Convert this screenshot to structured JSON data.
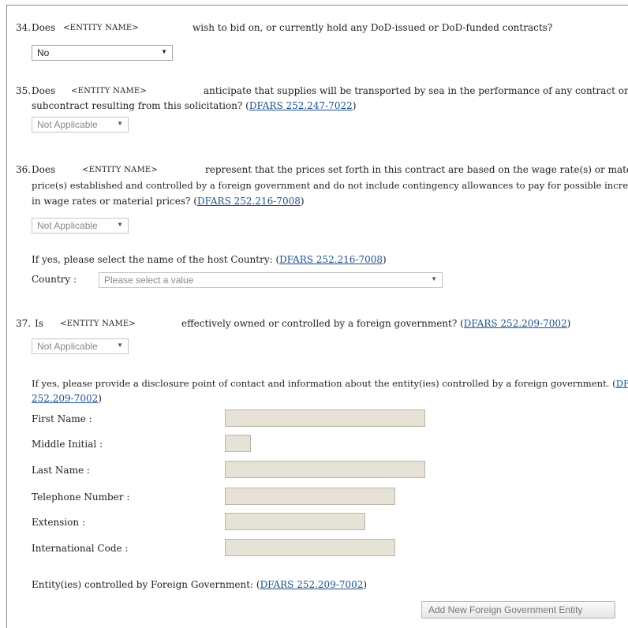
{
  "q34": {
    "number": "34.",
    "prefix": "Does",
    "entity": "<ENTITY NAME>",
    "text": "wish to bid on, or currently hold any DoD-issued or DoD-funded contracts?",
    "select_value": "No"
  },
  "q35": {
    "number": "35.",
    "prefix": "Does",
    "entity": "<ENTITY NAME>",
    "text_line1": "anticipate that supplies will be transported by sea in the performance of any contract or",
    "text_line2": "subcontract resulting from this solicitation? (",
    "ref": "DFARS 252.247-7022",
    "close": ")",
    "select_value": "Not Applicable"
  },
  "q36": {
    "number": "36.",
    "prefix": "Does",
    "entity": "<ENTITY NAME>",
    "text_line1": "represent that the prices set forth in this contract are based on the wage rate(s) or material",
    "text_line2": "price(s) established and controlled by a foreign government and do not include contingency allowances to pay for possible increases",
    "text_line3": "in wage rates or material prices? (",
    "ref": "DFARS 252.216-7008",
    "close": ")",
    "select_value": "Not Applicable",
    "country_prompt": "If yes, please select the name of the host Country: (",
    "country_ref": "DFARS 252.216-7008",
    "country_close": ")",
    "country_label": "Country :",
    "country_placeholder": "Please select a value"
  },
  "q37": {
    "number": "37.",
    "prefix": "Is",
    "entity": "<ENTITY NAME>",
    "text": "effectively owned or controlled by a foreign government? (",
    "ref": "DFARS 252.209-7002",
    "close": ")",
    "select_value": "Not Applicable",
    "disclosure_line1": "If yes, please provide a disclosure point of contact and information about the entity(ies) controlled by a foreign government. (",
    "disclosure_ref_part1": "DFAR",
    "disclosure_ref_part2": "252.209-7002",
    "disclosure_close": ")",
    "fields": {
      "first_name": "First Name :",
      "middle_initial": "Middle Initial :",
      "last_name": "Last Name :",
      "telephone": "Telephone Number :",
      "extension": "Extension :",
      "international_code": "International Code :"
    },
    "entities_label": "Entity(ies) controlled by Foreign Government: (",
    "entities_ref": "DFARS 252.209-7002",
    "entities_close": ")",
    "add_button": "Add New Foreign Government Entity"
  },
  "icons": {
    "dropdown": "triangle-down"
  }
}
